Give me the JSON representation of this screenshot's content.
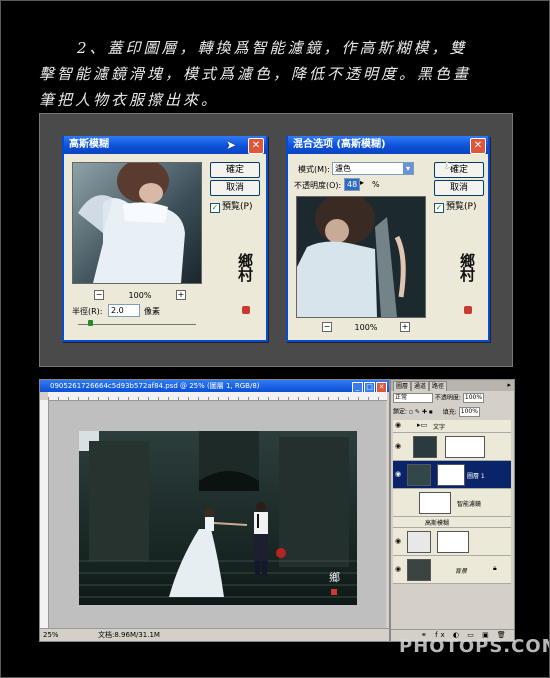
{
  "instruction": {
    "line1": "2、蓋印圖層，轉換爲智能濾鏡，作高斯糊模，雙",
    "line2": "擊智能濾鏡滑塊，模式爲濾色，降低不透明度。黑色畫",
    "line3": "筆把人物衣服擦出來。"
  },
  "gaussian_dialog": {
    "title": "高斯模糊",
    "ok": "確定",
    "cancel": "取消",
    "preview_label": "預覧(P)",
    "zoom": "100%",
    "radius_label": "半徑(R):",
    "radius_value": "2.0",
    "unit": "像素"
  },
  "blend_dialog": {
    "title": "混合选项 (高斯模糊)",
    "mode_label": "模式(M):",
    "mode_value": "濾色",
    "opacity_label": "不透明度(O):",
    "opacity_value": "48",
    "opacity_unit": "%",
    "ok": "確定",
    "cancel": "取消",
    "preview_label": "預覧(P)",
    "zoom": "100%"
  },
  "ps_window": {
    "title": "0905261726664c5d93b572af84.psd @ 25% (圖層 1, RGB/8)",
    "zoom_status": "25%",
    "doc_status": "文档:8.96M/31.1M"
  },
  "layers_panel": {
    "tabs": [
      "圖層",
      "通道",
      "路徑"
    ],
    "blend_mode": "正常",
    "opacity_label": "不透明度:",
    "opacity_value": "100%",
    "lock_label": "鎖定:",
    "fill_label": "填充:",
    "fill_value": "100%",
    "layers": [
      {
        "name": "文字"
      },
      {
        "name": ""
      },
      {
        "name": "圖層 1"
      },
      {
        "name": "智能濾鏡"
      },
      {
        "name": "高斯模糊"
      },
      {
        "name": ""
      },
      {
        "name": "背景"
      }
    ]
  },
  "watermark": "PHOTOPS.COM",
  "icons": {
    "close": "close-icon",
    "eye": "eye-icon",
    "folder": "folder-icon",
    "lock": "lock-icon",
    "cursor": "cursor-icon"
  },
  "colors": {
    "xp_title": "#0b4fd6",
    "dialog_bg": "#ece9d8",
    "selected_layer": "#0a246a",
    "seal": "#c83a32"
  }
}
